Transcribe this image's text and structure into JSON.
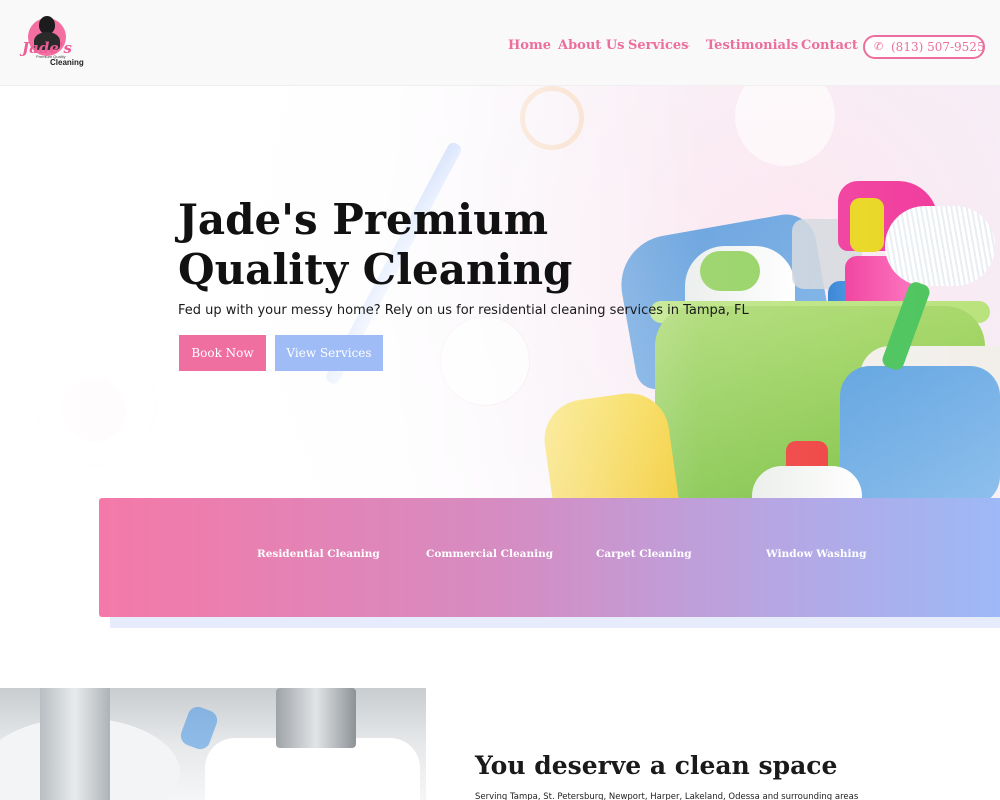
{
  "brand": {
    "logo_script": "Jade's",
    "logo_subtitle": "Premium Quality",
    "logo_word": "Cleaning"
  },
  "nav": {
    "items": [
      {
        "label": "Home"
      },
      {
        "label": "About Us"
      },
      {
        "label": "Services"
      },
      {
        "label": "Testimonials"
      },
      {
        "label": "Contact"
      }
    ],
    "phone": "(813) 507-9525"
  },
  "hero": {
    "title": "Jade's Premium Quality Cleaning",
    "subtitle": "Fed up with your messy home? Rely on us for residential cleaning services in Tampa, FL",
    "primary_button": "Book Now",
    "secondary_button": "View Services"
  },
  "services": [
    {
      "label": "Residential Cleaning"
    },
    {
      "label": "Commercial Cleaning"
    },
    {
      "label": "Carpet Cleaning"
    },
    {
      "label": "Window Washing"
    }
  ],
  "about": {
    "title": "You deserve a clean space",
    "text": "Serving Tampa, St. Petersburg, Newport, Harper, Lakeland, Odessa and surrounding areas"
  },
  "colors": {
    "accent_pink": "#ec6e9c",
    "button_pink": "#f06fa1",
    "button_blue": "#9fbcf6",
    "gradient_start": "#f479a8",
    "gradient_end": "#9db9f7"
  },
  "icons": {
    "phone": "phone-icon",
    "services_dropdown": "chevron-down-icon"
  }
}
